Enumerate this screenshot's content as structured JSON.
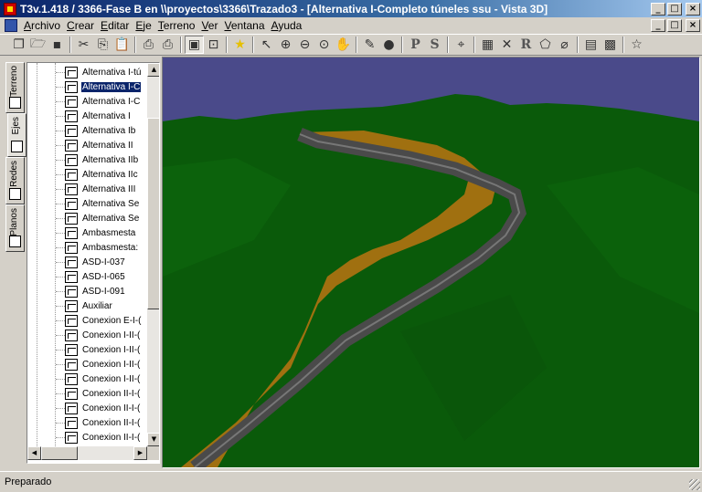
{
  "window": {
    "title": "T3v.1.418 / 3366-Fase B en \\\\proyectos\\3366\\Trazado3 - [Alternativa I-Completo túneles ssu - Vista 3D]",
    "minimize": "_",
    "maximize": "□",
    "close": "×"
  },
  "menu": {
    "items": [
      "Archivo",
      "Crear",
      "Editar",
      "Eje",
      "Terreno",
      "Ver",
      "Ventana",
      "Ayuda"
    ]
  },
  "toolbar": {
    "groups": [
      [
        "windows-icon",
        "open-folder-icon",
        "save-icon"
      ],
      [
        "cut-icon",
        "copy-icon",
        "paste-icon"
      ],
      [
        "print-preview-icon",
        "print-icon"
      ],
      [
        "window-layout-icon",
        "zoom-window-icon"
      ],
      [
        "star-icon"
      ],
      [
        "pointer-icon",
        "zoom-in-icon",
        "zoom-out-icon",
        "zoom-extents-icon",
        "pan-hand-icon"
      ],
      [
        "pen-icon",
        "sphere-icon"
      ],
      [
        "plan-icon",
        "section-icon"
      ],
      [
        "measure-icon"
      ],
      [
        "grid-icon",
        "cross-icon",
        "r-icon",
        "polygon-icon",
        "lasso-icon"
      ],
      [
        "calendar-icon",
        "palette-icon"
      ],
      [
        "star-outline-icon"
      ]
    ],
    "letters": {
      "plan-icon": "P",
      "section-icon": "S",
      "r-icon": "R"
    }
  },
  "sidetabs": [
    {
      "label": "Terreno",
      "active": false
    },
    {
      "label": "Ejes",
      "active": true
    },
    {
      "label": "Redes",
      "active": false
    },
    {
      "label": "Planos",
      "active": false
    }
  ],
  "tree": {
    "selected_index": 1,
    "items": [
      "Alternativa I-tú",
      "Alternativa I-C",
      "Alternativa I-C",
      "Alternativa I",
      "Alternativa Ib",
      "Alternativa II",
      "Alternativa IIb",
      "Alternativa IIc",
      "Alternativa III",
      "Alternativa Se",
      "Alternativa Se",
      "Ambasmesta",
      "Ambasmesta:",
      "ASD-I-037",
      "ASD-I-065",
      "ASD-I-091",
      "Auxiliar",
      "Conexion E-I-(",
      "Conexion I-II-(",
      "Conexion I-II-(",
      "Conexion I-II-(",
      "Conexion I-II-(",
      "Conexion II-I-(",
      "Conexion II-I-(",
      "Conexion II-I-(",
      "Conexion II-I-("
    ]
  },
  "scroll": {
    "up": "▲",
    "down": "▼",
    "left": "◀",
    "right": "▶"
  },
  "view3d": {
    "sky_color": "#4a4a8a",
    "terrain_color": "#0a5a0a",
    "earthwork_color": "#a07010",
    "road_color": "#4a4a4a"
  },
  "status": {
    "text": "Preparado"
  }
}
